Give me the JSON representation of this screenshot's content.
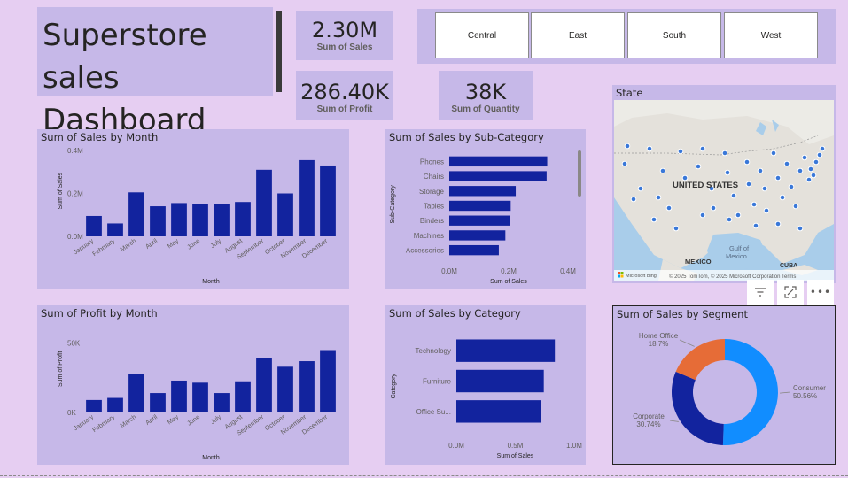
{
  "title": {
    "line1": "Superstore sales",
    "line2": "Dashboard"
  },
  "kpis": {
    "sales": {
      "value": "2.30M",
      "label": "Sum of Sales"
    },
    "profit": {
      "value": "286.40K",
      "label": "Sum of Profit"
    },
    "quantity": {
      "value": "38K",
      "label": "Sum of Quantity"
    }
  },
  "slicer": {
    "regions": [
      "Central",
      "East",
      "South",
      "West"
    ]
  },
  "map": {
    "title": "State",
    "labels": {
      "us": "UNITED STATES",
      "mexico": "MEXICO",
      "gulf": "Gulf of\nMexico",
      "cuba": "CUBA"
    },
    "attribution": "© 2025 TomTom, © 2025 Microsoft Corporation Terms",
    "bing": "Microsoft Bing"
  },
  "colors": {
    "bar": "#12239e",
    "consumer": "#118dff",
    "corporate": "#12239e",
    "home_office": "#e66c37",
    "panel": "#c6b8e8",
    "background": "#e6cef2"
  },
  "icons": [
    "filter-icon",
    "focus-mode-icon",
    "more-options-icon"
  ],
  "chart_data": [
    {
      "id": "sales_by_month",
      "type": "bar",
      "title": "Sum of Sales by Month",
      "xlabel": "Month",
      "ylabel": "Sum of Sales",
      "ylim": [
        0,
        400000
      ],
      "yticks": [
        "0.0M",
        "0.2M",
        "0.4M"
      ],
      "categories": [
        "January",
        "February",
        "March",
        "April",
        "May",
        "June",
        "July",
        "August",
        "September",
        "October",
        "November",
        "December"
      ],
      "values": [
        95000,
        60000,
        205000,
        140000,
        155000,
        150000,
        150000,
        160000,
        310000,
        200000,
        355000,
        330000
      ]
    },
    {
      "id": "sales_by_subcategory",
      "type": "bar",
      "orientation": "horizontal",
      "title": "Sum of Sales by Sub-Category",
      "xlabel": "Sum of Sales",
      "ylabel": "Sub-Category",
      "xlim": [
        0,
        400000
      ],
      "xticks": [
        "0.0M",
        "0.2M",
        "0.4M"
      ],
      "categories": [
        "Phones",
        "Chairs",
        "Storage",
        "Tables",
        "Binders",
        "Machines",
        "Accessories"
      ],
      "values": [
        330000,
        328000,
        224000,
        207000,
        203000,
        189000,
        167000
      ]
    },
    {
      "id": "profit_by_month",
      "type": "bar",
      "title": "Sum of Profit by Month",
      "xlabel": "Month",
      "ylabel": "Sum of Profit",
      "ylim": [
        0,
        60000
      ],
      "yticks": [
        "0K",
        "50K"
      ],
      "categories": [
        "January",
        "February",
        "March",
        "April",
        "May",
        "June",
        "July",
        "August",
        "September",
        "October",
        "November",
        "December"
      ],
      "values": [
        9000,
        10500,
        28000,
        14000,
        23000,
        21500,
        14000,
        22500,
        39500,
        33000,
        37000,
        45000
      ]
    },
    {
      "id": "sales_by_category",
      "type": "bar",
      "orientation": "horizontal",
      "title": "Sum of Sales by Category",
      "xlabel": "Sum of Sales",
      "ylabel": "Category",
      "xlim": [
        0,
        1000000
      ],
      "xticks": [
        "0.0M",
        "0.5M",
        "1.0M"
      ],
      "categories": [
        "Technology",
        "Furniture",
        "Office Su..."
      ],
      "values": [
        836000,
        742000,
        719000
      ]
    },
    {
      "id": "sales_by_segment",
      "type": "pie",
      "donut": true,
      "title": "Sum of Sales by Segment",
      "categories": [
        "Consumer",
        "Corporate",
        "Home Office"
      ],
      "values": [
        50.56,
        30.74,
        18.7
      ],
      "labels": [
        "50.56%",
        "30.74%",
        "18.7%"
      ]
    }
  ]
}
